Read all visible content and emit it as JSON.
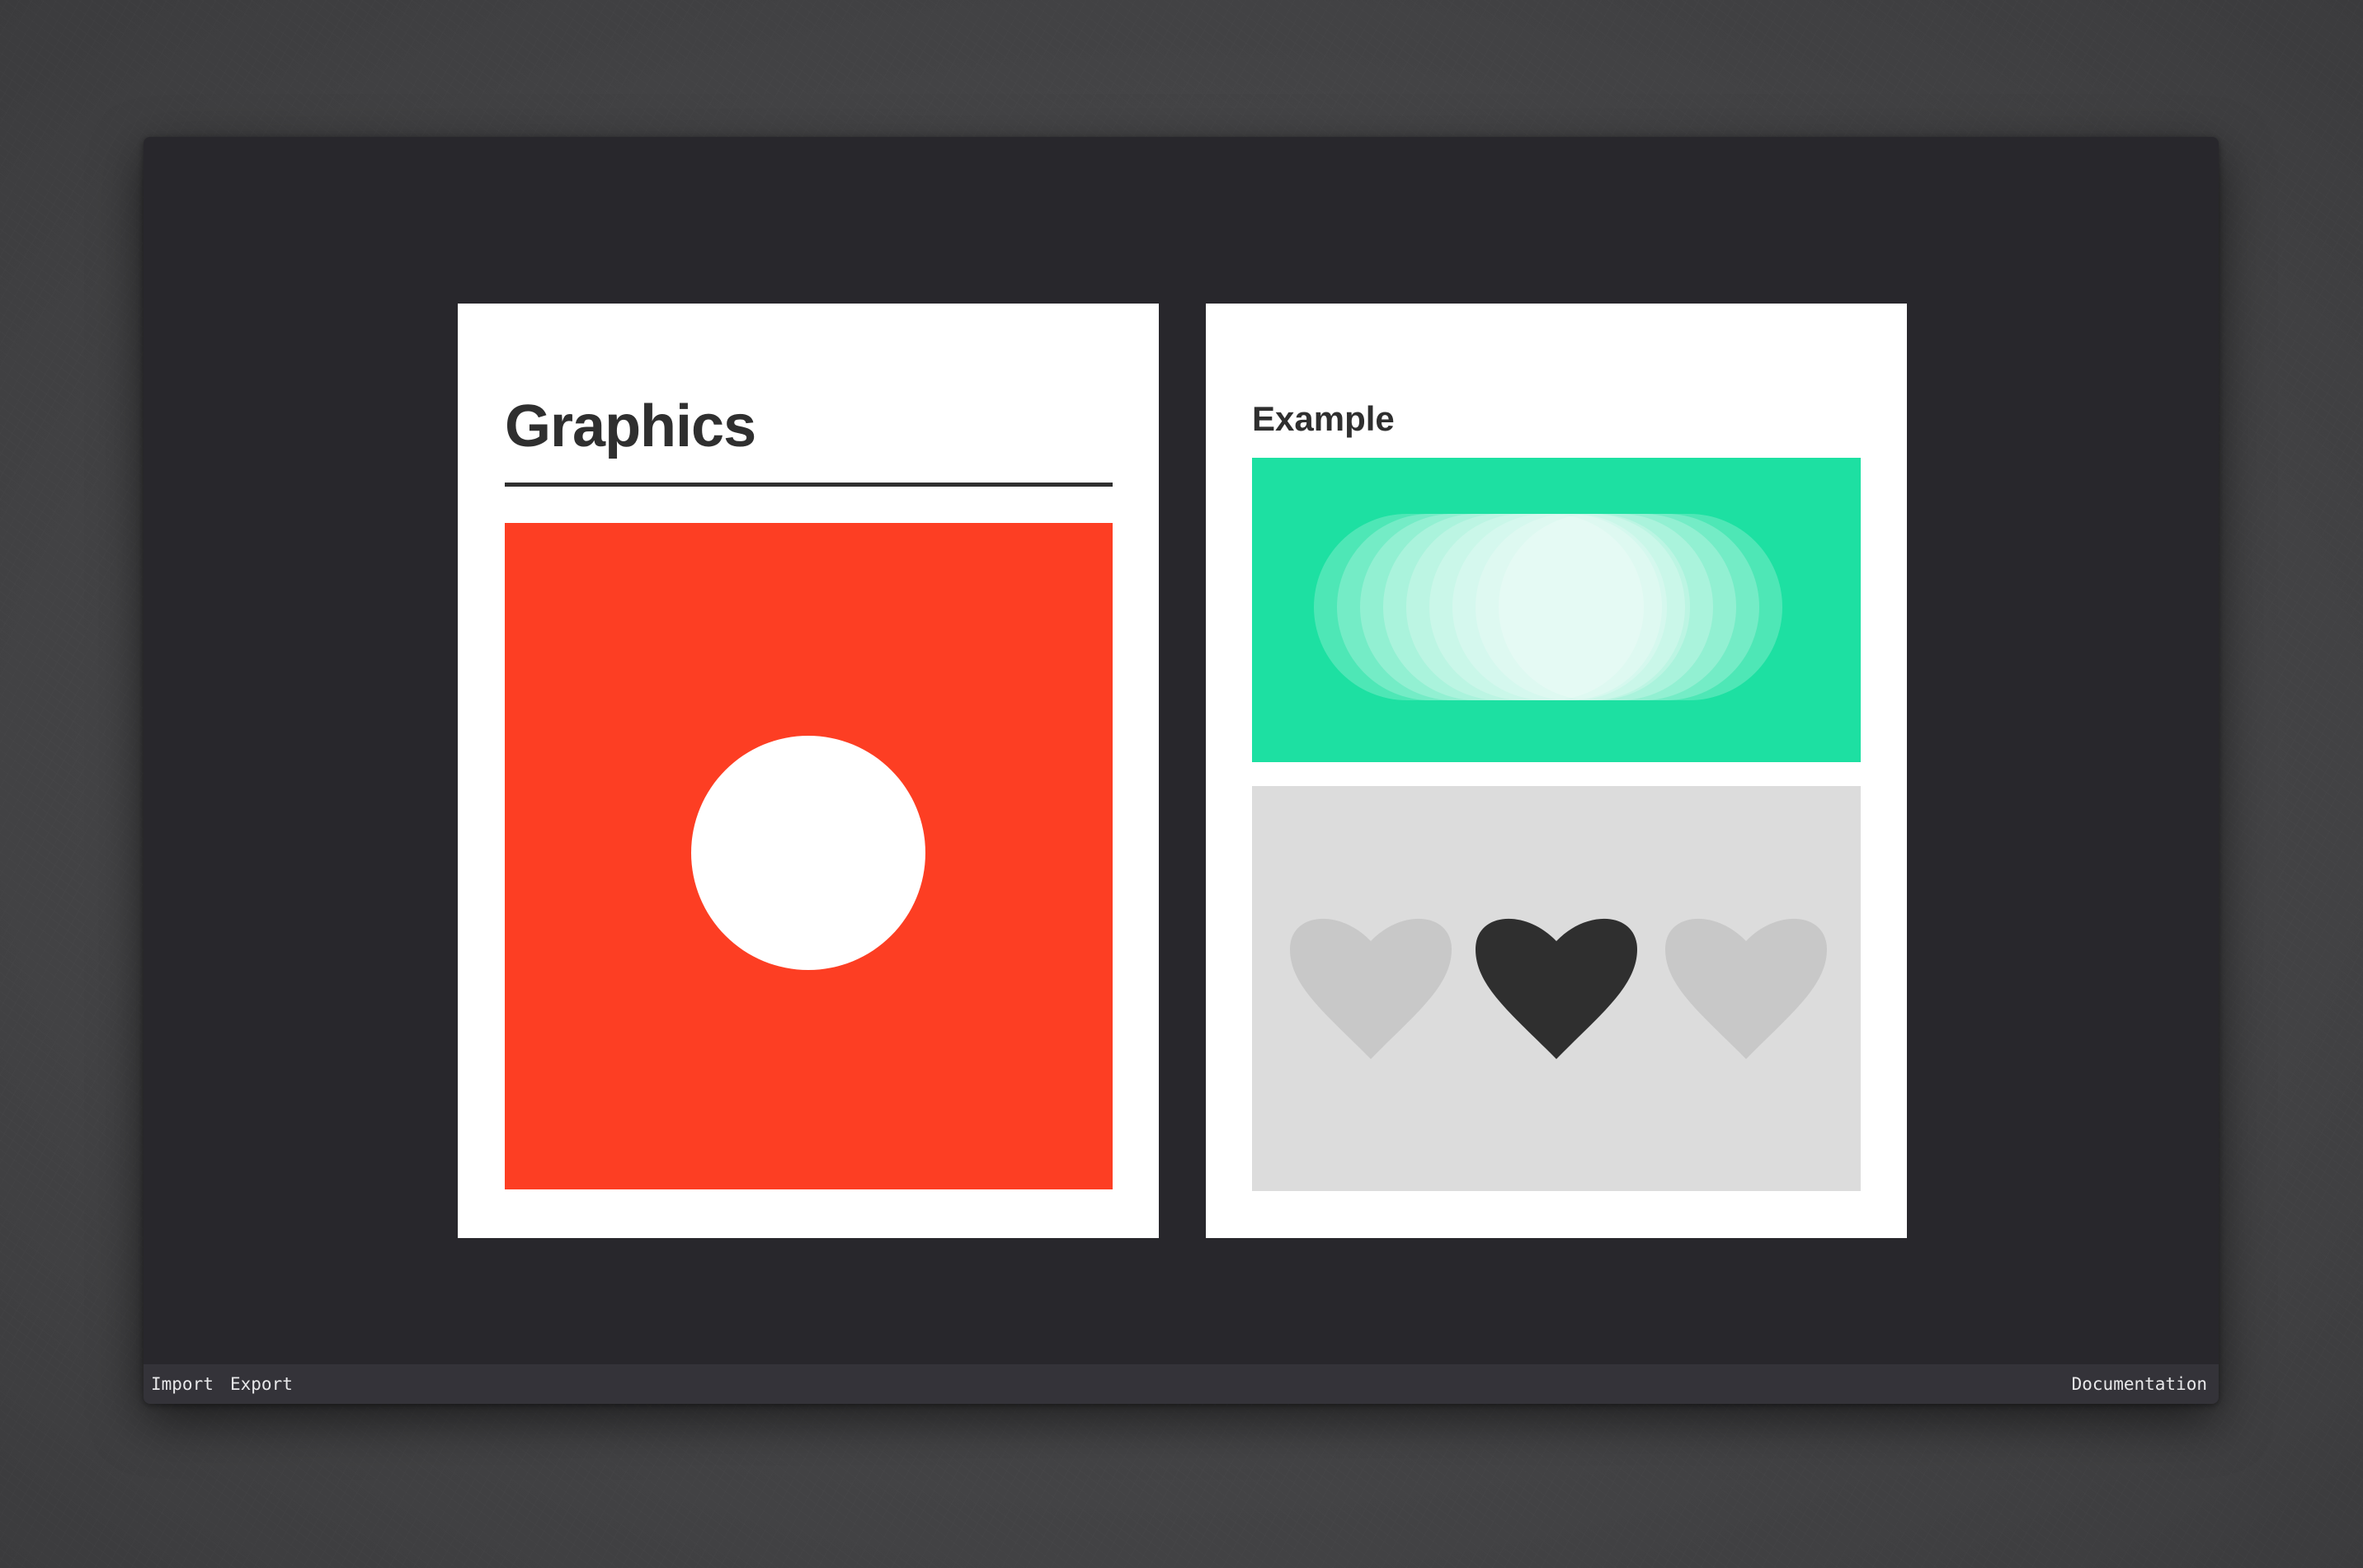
{
  "colors": {
    "canvas_bg": "#28272c",
    "page_bg": "#ffffff",
    "heading": "#2f2f2f",
    "red": "#fd3e23",
    "green": "#1de0a2",
    "gray_panel": "#dcdcdc",
    "heart_light": "#c8c8c8",
    "heart_dark": "#2f2f2f",
    "statusbar_bg": "#343339"
  },
  "pages": [
    {
      "title": "Graphics",
      "graphic": "red-square-with-white-circle"
    },
    {
      "title": "Example",
      "graphics": [
        "green-panel-with-pill-gradient",
        "gray-panel-with-three-hearts"
      ],
      "hearts": [
        {
          "icon": "heart-icon",
          "state": "inactive"
        },
        {
          "icon": "heart-icon",
          "state": "active"
        },
        {
          "icon": "heart-icon",
          "state": "inactive"
        }
      ]
    }
  ],
  "statusbar": {
    "import_label": "Import",
    "export_label": "Export",
    "documentation_label": "Documentation"
  }
}
